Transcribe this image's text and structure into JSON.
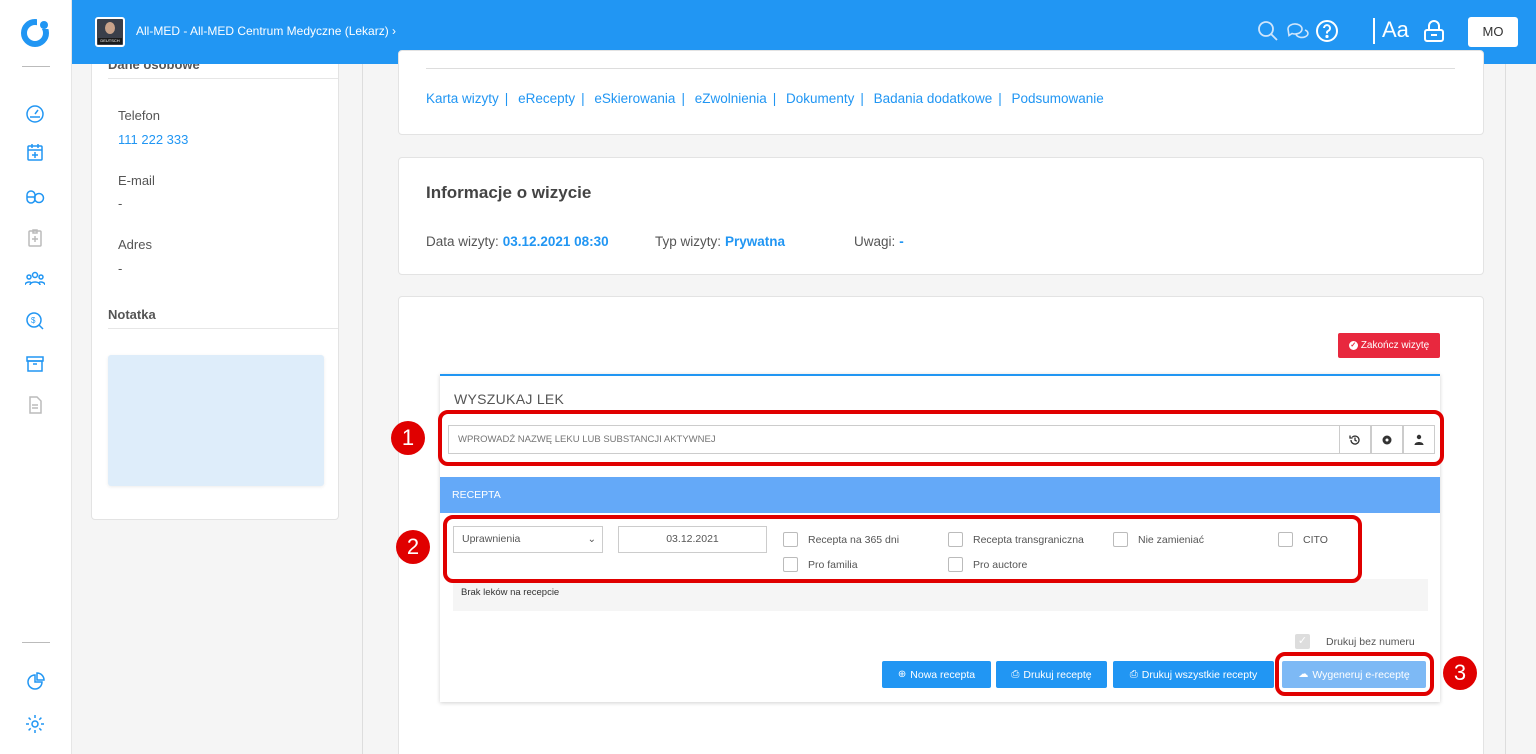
{
  "header": {
    "clinic_name": "All-MED - All-MED Centrum Medyczne (Lekarz) ›",
    "avatar_tag": "DEUTSCH",
    "font_toggle": "Aa",
    "user_initials": "MO"
  },
  "sidebar_icons": [
    "dashboard-icon",
    "calendar-add-icon",
    "pills-icon",
    "clipboard-medical-icon",
    "users-icon",
    "search-money-icon",
    "archive-icon",
    "document-icon",
    "pie-chart-icon",
    "settings-gear-icon"
  ],
  "patient": {
    "section_title": "Dane osobowe",
    "phone_label": "Telefon",
    "phone_value": "111 222 333",
    "email_label": "E-mail",
    "email_value": "-",
    "address_label": "Adres",
    "address_value": "-",
    "note_label": "Notatka"
  },
  "visit_nav": {
    "links": [
      "Karta wizyty",
      "eRecepty",
      "eSkierowania",
      "eZwolnienia",
      "Dokumenty",
      "Badania dodatkowe",
      "Podsumowanie"
    ],
    "separator": "|"
  },
  "visit_info": {
    "title": "Informacje o wizycie",
    "date_label": "Data wizyty:",
    "date_value": "03.12.2021 08:30",
    "type_label": "Typ wizyty:",
    "type_value": "Prywatna",
    "notes_label": "Uwagi:",
    "notes_value": "-"
  },
  "end_visit_button": "Zakończ wizytę",
  "drug_search": {
    "title": "WYSZUKAJ LEK",
    "placeholder": "WPROWADŹ NAZWĘ LEKU LUB SUBSTANCJI AKTYWNEJ",
    "buttons": [
      "history-icon",
      "gear-icon",
      "pharmacist-icon"
    ]
  },
  "prescription": {
    "header": "RECEPTA",
    "permissions_select": "Uprawnienia",
    "date": "03.12.2021",
    "checkboxes": {
      "r365": "Recepta na 365 dni",
      "transborder": "Recepta transgraniczna",
      "no_substitute": "Nie zamieniać",
      "cito": "CITO",
      "pro_familia": "Pro familia",
      "pro_auctore": "Pro auctore"
    },
    "empty_text": "Brak leków na recepcie",
    "print_without_number": "Drukuj bez numeru"
  },
  "actions": {
    "new": "Nowa recepta",
    "print": "Drukuj receptę",
    "print_all": "Drukuj wszystkie recepty",
    "generate": "Wygeneruj e-receptę"
  },
  "callouts": [
    "1",
    "2",
    "3"
  ],
  "colors": {
    "primary": "#2196f3",
    "danger": "#e8283e",
    "highlight": "#e00000",
    "recepta_bar": "#64a9f8"
  }
}
